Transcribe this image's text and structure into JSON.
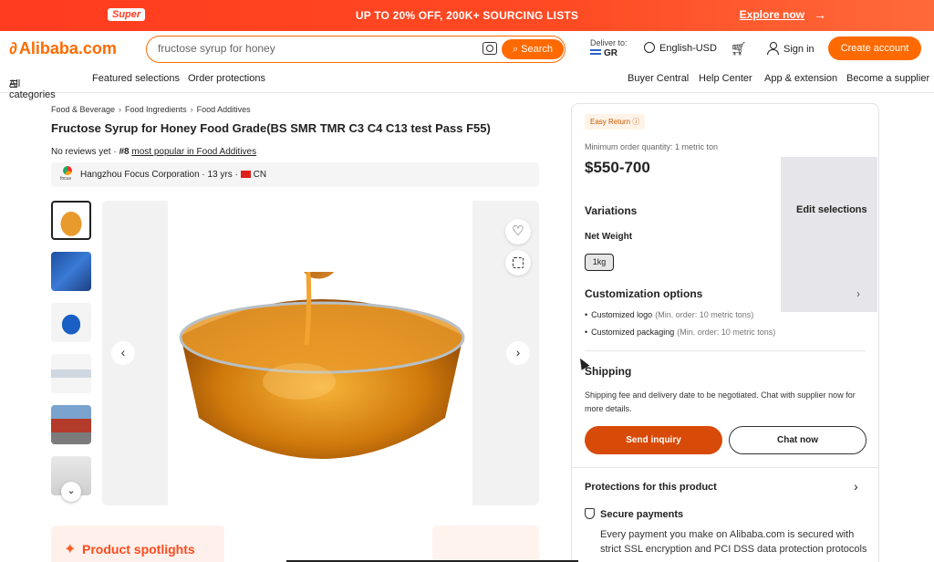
{
  "promo": {
    "badge": "Super",
    "headline": "UP TO 20% OFF, 200K+ SOURCING LISTS",
    "cta": "Explore now",
    "colors": {
      "background": "#ff3b1f",
      "text": "#ffffff"
    }
  },
  "header": {
    "logo": "Alibaba.com",
    "search_value": "fructose syrup for honey",
    "search_button": "Search",
    "deliver_label": "Deliver to:",
    "deliver_country": "GR",
    "language": "English-USD",
    "sign_in": "Sign in",
    "create_account": "Create account",
    "accent": "#ff6a00",
    "icons": [
      "camera-icon",
      "globe-icon",
      "cart-icon",
      "person-icon"
    ]
  },
  "nav": {
    "all_categories": "All categories",
    "featured": "Featured selections",
    "orders": "Order protections",
    "buyer_central": "Buyer Central",
    "help": "Help Center",
    "app": "App & extension",
    "supplier": "Become a supplier"
  },
  "product": {
    "breadcrumbs": [
      "Food & Beverage",
      "Food Ingredients",
      "Food Additives"
    ],
    "title": "Fructose Syrup for Honey Food Grade(BS SMR TMR C3 C4 C13 test Pass F55)",
    "reviews": "No reviews yet",
    "rank": "#8",
    "rank_text": "most popular in Food Additives",
    "supplier_name": "Hangzhou Focus Corporation",
    "supplier_years": "13 yrs",
    "supplier_country": "CN"
  },
  "gallery": {
    "thumbnails": [
      "honey-bowl",
      "ibc-tank",
      "blue-drum",
      "syrup-spoon",
      "truck-loading",
      "warehouse"
    ],
    "selected_index": 0
  },
  "panel": {
    "easy_return": "Easy Return",
    "moq": "Minimum order quantity: 1 metric ton",
    "price": "$550-700",
    "variations": "Variations",
    "edit_selections": "Edit selections",
    "net_weight_label": "Net Weight",
    "net_weight_value": "1kg",
    "customization": "Customization options",
    "custom_items": [
      {
        "name": "Customized logo",
        "min": "(Min. order: 10 metric tons)"
      },
      {
        "name": "Customized packaging",
        "min": "(Min. order: 10 metric tons)"
      }
    ],
    "shipping_title": "Shipping",
    "shipping_text": "Shipping fee and delivery date to be negotiated. Chat with supplier now for more details.",
    "send_inquiry": "Send inquiry",
    "chat_now": "Chat now",
    "protections": "Protections for this product",
    "secure_title": "Secure payments",
    "secure_text": "Every payment you make on Alibaba.com is secured with strict SSL encryption and PCI DSS data protection protocols"
  },
  "spotlights": {
    "label": "Product spotlights"
  }
}
